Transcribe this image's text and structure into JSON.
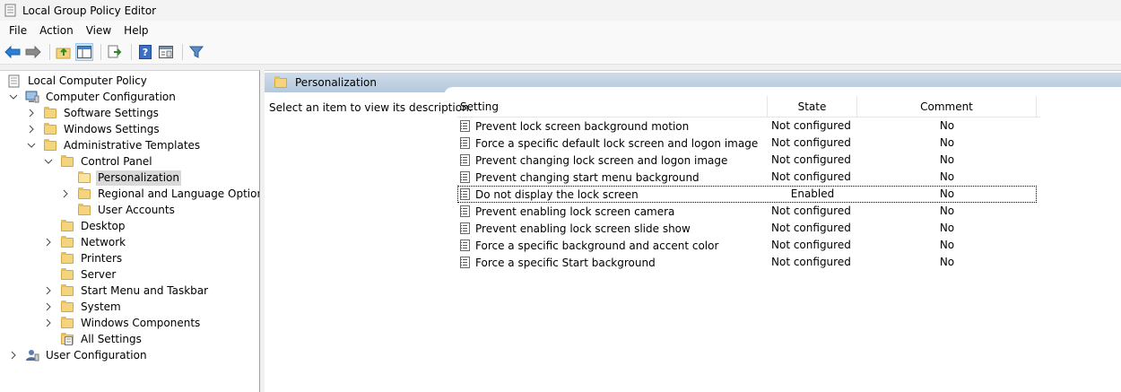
{
  "window": {
    "title": "Local Group Policy Editor"
  },
  "menu": [
    "File",
    "Action",
    "View",
    "Help"
  ],
  "toolbar": {
    "icons": [
      "back-arrow-icon",
      "forward-arrow-icon",
      "up-folder-icon",
      "show-hide-tree-icon",
      "export-list-icon",
      "help-icon",
      "properties-icon",
      "filter-icon"
    ]
  },
  "tree": {
    "root": "Local Computer Policy",
    "computer_configuration": "Computer Configuration",
    "software_settings": "Software Settings",
    "windows_settings": "Windows Settings",
    "administrative_templates": "Administrative Templates",
    "control_panel": "Control Panel",
    "personalization": "Personalization",
    "regional_language": "Regional and Language Options",
    "user_accounts": "User Accounts",
    "desktop": "Desktop",
    "network": "Network",
    "printers": "Printers",
    "server": "Server",
    "start_menu": "Start Menu and Taskbar",
    "system": "System",
    "windows_components": "Windows Components",
    "all_settings": "All Settings",
    "user_configuration": "User Configuration"
  },
  "content": {
    "header": "Personalization",
    "description": "Select an item to view its description.",
    "columns": {
      "setting": "Setting",
      "state": "State",
      "comment": "Comment"
    },
    "rows": [
      {
        "setting": "Prevent lock screen background motion",
        "state": "Not configured",
        "comment": "No"
      },
      {
        "setting": "Force a specific default lock screen and logon image",
        "state": "Not configured",
        "comment": "No"
      },
      {
        "setting": "Prevent changing lock screen and logon image",
        "state": "Not configured",
        "comment": "No"
      },
      {
        "setting": "Prevent changing start menu background",
        "state": "Not configured",
        "comment": "No"
      },
      {
        "setting": "Do not display the lock screen",
        "state": "Enabled",
        "comment": "No"
      },
      {
        "setting": "Prevent enabling lock screen camera",
        "state": "Not configured",
        "comment": "No"
      },
      {
        "setting": "Prevent enabling lock screen slide show",
        "state": "Not configured",
        "comment": "No"
      },
      {
        "setting": "Force a specific background and accent color",
        "state": "Not configured",
        "comment": "No"
      },
      {
        "setting": "Force a specific Start background",
        "state": "Not configured",
        "comment": "No"
      }
    ]
  }
}
